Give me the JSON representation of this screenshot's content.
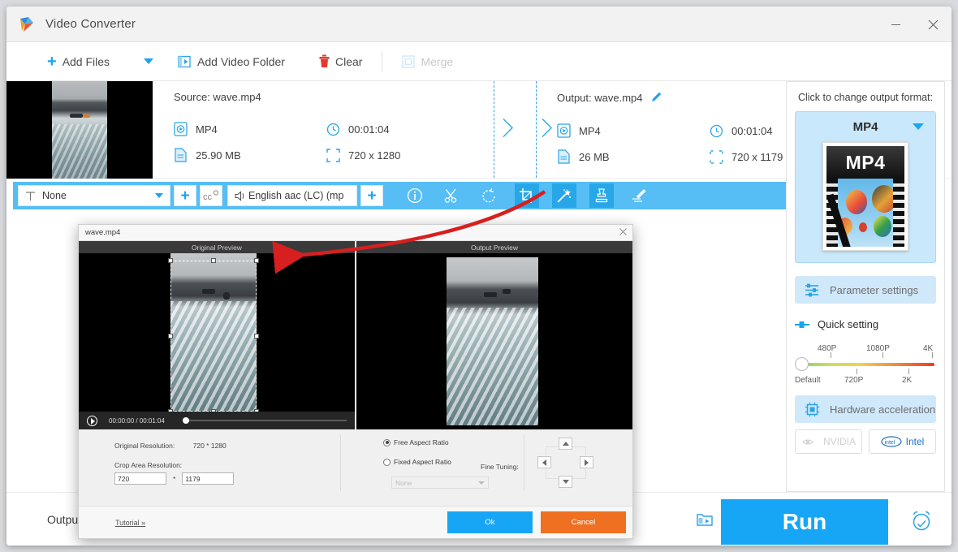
{
  "window": {
    "title": "Video Converter",
    "logo_icon": "app-logo-icon",
    "minimize_label": "—",
    "close_label": "✕"
  },
  "toolbar": {
    "add_files": "Add Files",
    "add_files_caret": "chevron-down-icon",
    "add_video_folder": "Add Video Folder",
    "clear": "Clear",
    "merge": "Merge"
  },
  "file_row": {
    "source_label": "Source: wave.mp4",
    "output_label": "Output: wave.mp4",
    "edit_icon": "pencil-icon",
    "close_icon": "close-icon",
    "source": {
      "format": "MP4",
      "duration": "00:01:04",
      "size": "25.90 MB",
      "resolution": "720 x 1280"
    },
    "output": {
      "format": "MP4",
      "duration": "00:01:04",
      "size": "26 MB",
      "resolution": "720 x 1179"
    }
  },
  "tool_strip": {
    "subtitle_value": "None",
    "subtitle_icon": "subtitle-T-icon",
    "add_subtitle": "+",
    "cc_icon": "cc-settings-icon",
    "audio_value": "English aac (LC) (mp",
    "audio_icon": "speaker-icon",
    "add_audio": "+",
    "tools": [
      {
        "name": "info-icon",
        "active": false
      },
      {
        "name": "cut-scissors-icon",
        "active": false
      },
      {
        "name": "rotate-icon",
        "active": false
      },
      {
        "name": "crop-icon",
        "active": true
      },
      {
        "name": "effect-wand-icon",
        "active": true
      },
      {
        "name": "watermark-stamp-icon",
        "active": true
      },
      {
        "name": "edit-subtitle-icon",
        "active": false
      }
    ]
  },
  "right_panel": {
    "heading": "Click to change output format:",
    "format_name": "MP4",
    "format_caret": "chevron-down-icon",
    "format_thumb_label": "MP4",
    "parameter_settings": "Parameter settings",
    "parameter_icon": "sliders-icon",
    "quick_setting": "Quick setting",
    "quick_setting_icon": "toggle-icon",
    "slider": {
      "value": "Default",
      "top_ticks": [
        "480P",
        "1080P",
        "4K"
      ],
      "bottom_ticks": [
        "Default",
        "720P",
        "2K"
      ]
    },
    "hardware_acceleration": "Hardware acceleration",
    "hardware_icon": "cpu-chip-icon",
    "chips": [
      {
        "label": "NVIDIA",
        "enabled": false,
        "icon": "nvidia-icon"
      },
      {
        "label": "Intel",
        "enabled": true,
        "icon": "intel-icon"
      }
    ]
  },
  "bottom_bar": {
    "output_folder_label": "Output f",
    "folder_icon": "output-folder-icon",
    "run_label": "Run",
    "clock_icon": "alarm-clock-icon"
  },
  "crop_dialog": {
    "title": "wave.mp4",
    "close_icon": "close-icon",
    "original_preview_caption": "Original Preview",
    "output_preview_caption": "Output Preview",
    "player": {
      "play_icon": "play-icon",
      "time": "00:00:00  /  00:01:04"
    },
    "original_resolution_label": "Original Resolution:",
    "original_resolution_value": "720 * 1280",
    "crop_area_label": "Crop Area Resolution:",
    "crop_width": "720",
    "crop_multiply": "*",
    "crop_height": "1179",
    "free_aspect_ratio": "Free Aspect Ratio",
    "fixed_aspect_ratio": "Fixed Aspect Ratio",
    "aspect_select_value": "None",
    "fine_tuning_label": "Fine Tuning:",
    "nudge_up": "up-arrow-icon",
    "nudge_down": "down-arrow-icon",
    "nudge_left": "left-arrow-icon",
    "nudge_right": "right-arrow-icon",
    "tutorial": "Tutorial »",
    "ok": "Ok",
    "cancel": "Cancel"
  },
  "annotation": {
    "arrow_color": "#d81f1f",
    "arrow_target": "crop-icon"
  },
  "colors": {
    "accent_blue": "#16a6f5",
    "strip_blue": "#56bef4",
    "cancel_orange": "#ef7020",
    "panel_light_blue": "#c9e8fb"
  }
}
